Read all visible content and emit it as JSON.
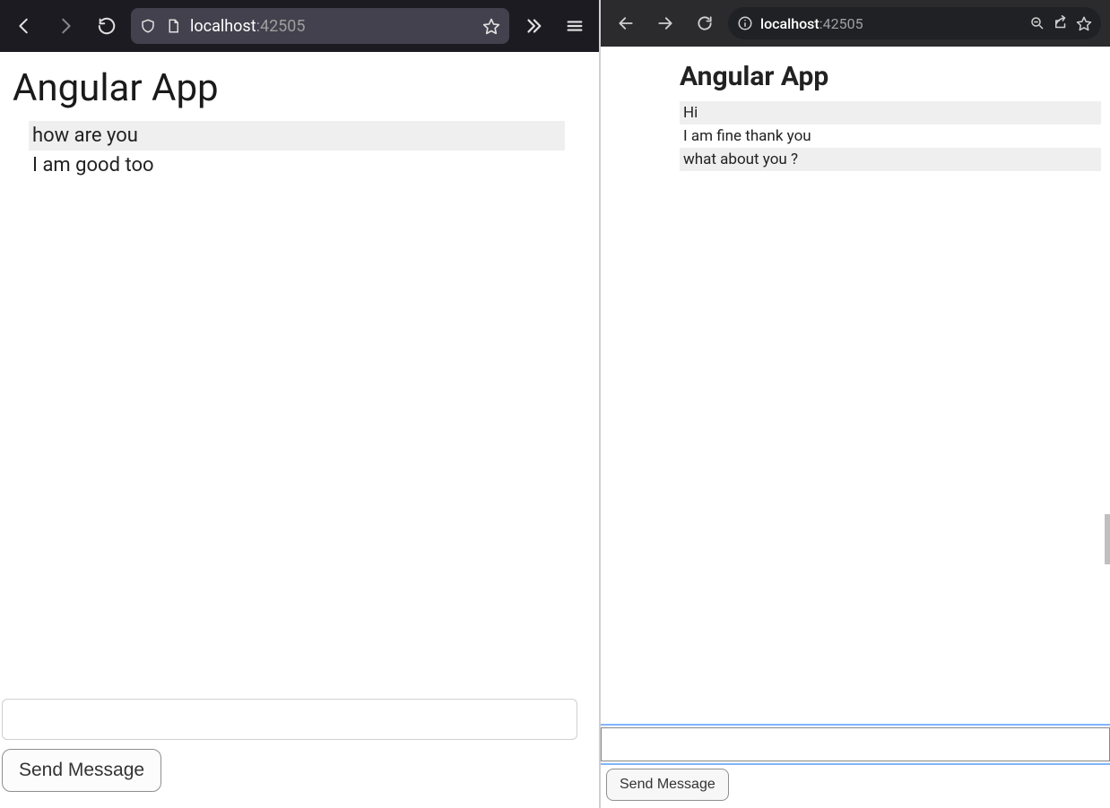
{
  "left": {
    "chrome": {
      "url_host": "localhost",
      "url_port": ":42505",
      "icons": {
        "back": "back-icon",
        "forward": "forward-icon",
        "reload": "reload-icon",
        "shield": "shield-icon",
        "page": "page-icon",
        "star": "star-icon",
        "overflow": "overflow-chevrons-icon",
        "menu": "hamburger-icon"
      }
    },
    "page": {
      "title": "Angular App",
      "messages": [
        "how are you",
        "I am good too"
      ],
      "input_value": "",
      "send_label": "Send Message"
    }
  },
  "right": {
    "chrome": {
      "url_host": "localhost",
      "url_port": ":42505",
      "icons": {
        "back": "back-icon",
        "forward": "forward-icon",
        "reload": "reload-icon",
        "info": "info-icon",
        "zoom": "zoom-icon",
        "share": "share-icon",
        "star": "star-icon"
      }
    },
    "page": {
      "title": "Angular App",
      "messages": [
        "Hi",
        "I am fine thank you",
        "what about you ?"
      ],
      "input_value": "",
      "send_label": "Send Message"
    }
  }
}
